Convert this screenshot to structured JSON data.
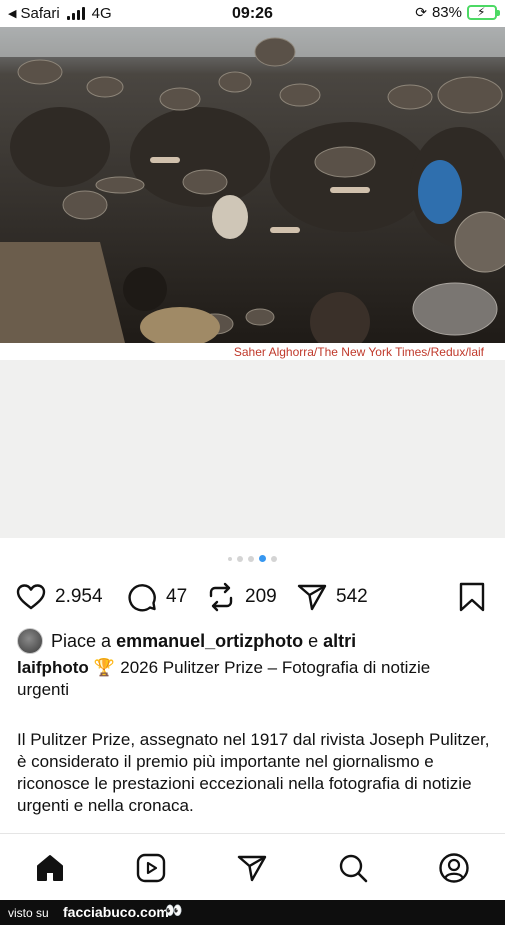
{
  "status_bar": {
    "back_app": "Safari",
    "network": "4G",
    "time": "09:26",
    "battery_percent": "83%",
    "battery_level": 0.83
  },
  "post": {
    "image_credit": "Saher Alghorra/The New York Times/Redux/laif",
    "carousel": {
      "count": 5,
      "active_index": 3
    },
    "stats": {
      "likes": "2.954",
      "comments": "47",
      "reposts": "209",
      "shares": "542"
    },
    "liked_by": {
      "prefix": "Piace a",
      "user": "emmanuel_ortizphoto",
      "joiner": "e",
      "others": "altri"
    },
    "author": "laifphoto",
    "caption_emoji": "🏆",
    "caption_text": "2026 Pulitzer Prize – Fotografia di notizie urgenti",
    "body": "Il Pulitzer Prize, assegnato nel 1917 dal rivista Joseph Pulitzer, è considerato il premio più importante nel giornalismo e riconosce le prestazioni eccezionali nella fotografia di notizie urgenti e nella cronaca."
  },
  "tabbar": {
    "icons": [
      "home-icon",
      "reels-icon",
      "direct-icon",
      "search-icon",
      "profile-icon"
    ]
  },
  "footer": {
    "prefix": "visto su",
    "site": "facciabuco.com",
    "mascot": "👀"
  },
  "colors": {
    "accent": "#3797f0",
    "credit_text": "#c0392b",
    "battery": "#4cd964"
  }
}
